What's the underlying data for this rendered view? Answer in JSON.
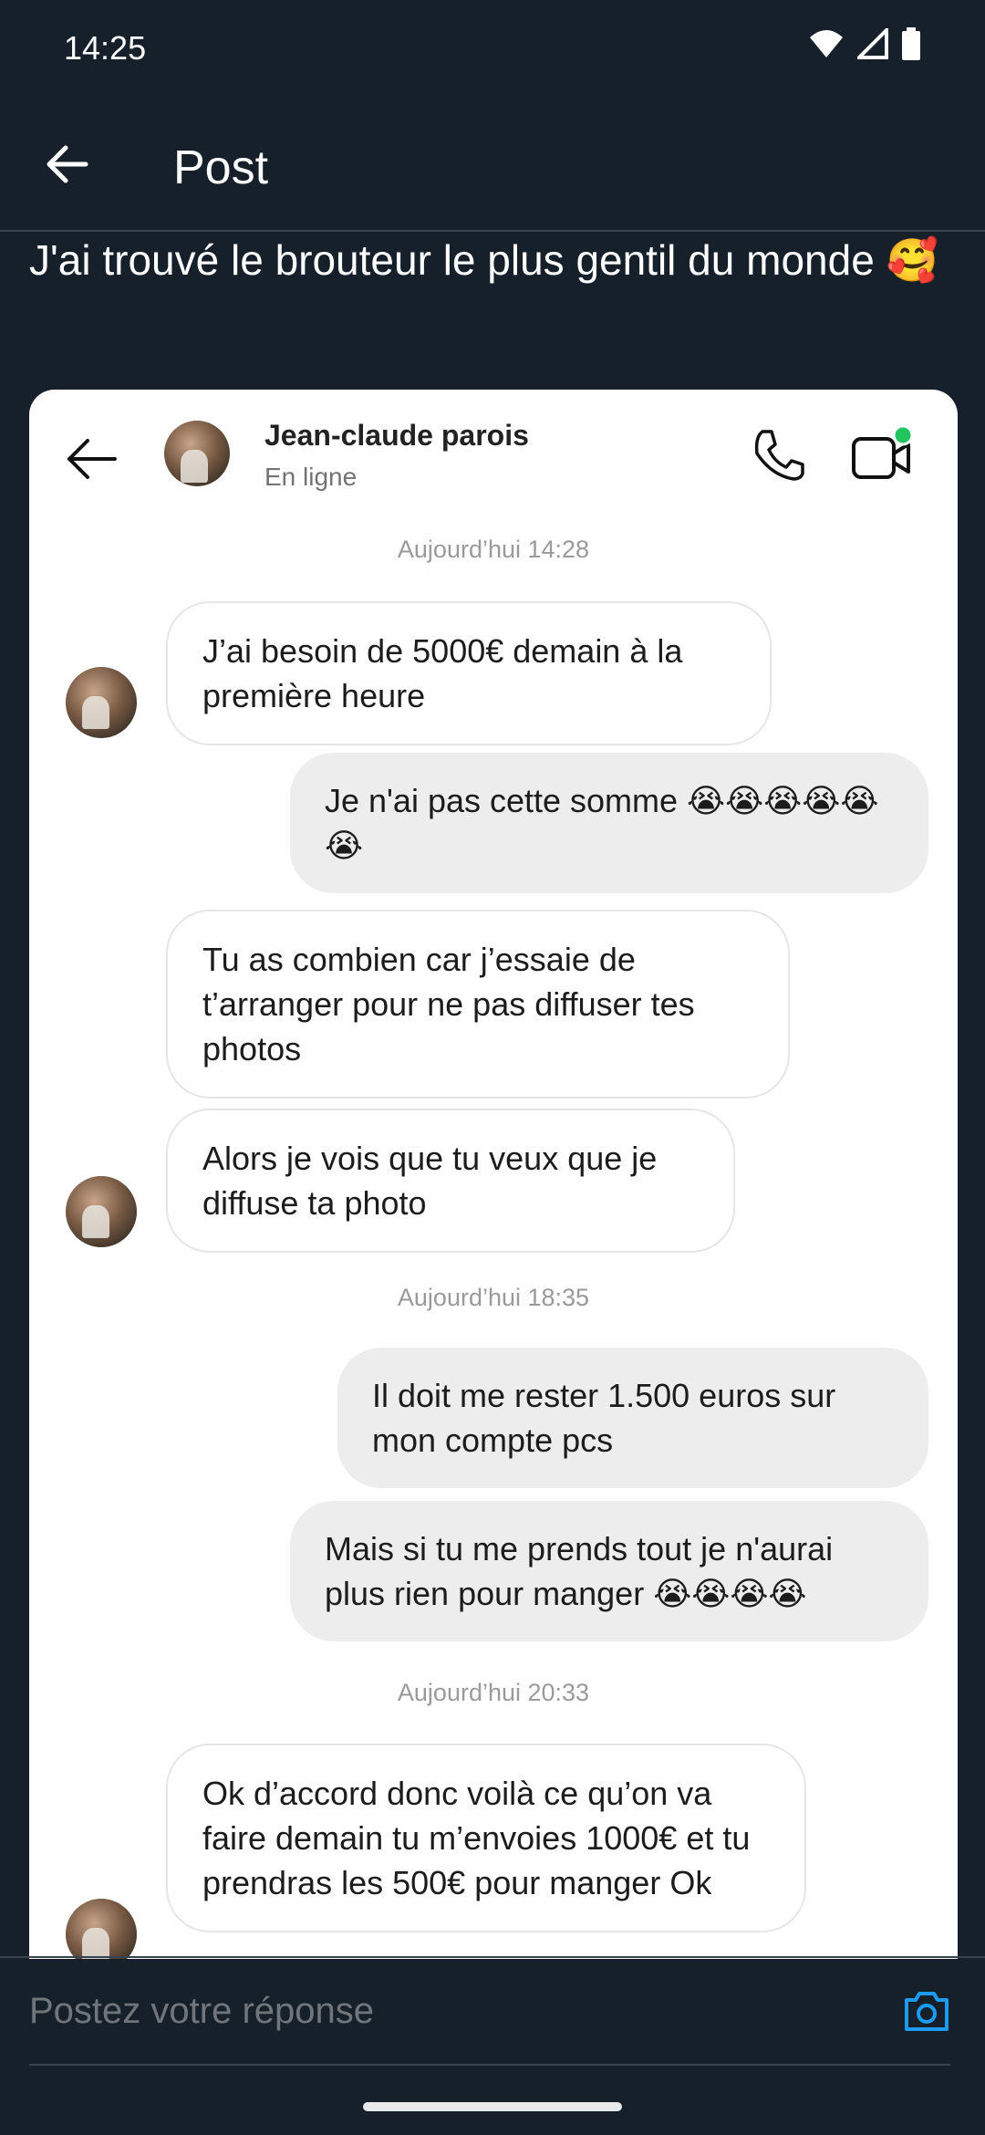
{
  "status_bar": {
    "time": "14:25"
  },
  "app_bar": {
    "title": "Post"
  },
  "post": {
    "text": "J'ai trouvé le brouteur le plus gentil du monde",
    "emoji": "🥰"
  },
  "chat": {
    "contact_name": "Jean-claude parois",
    "contact_status": "En ligne",
    "messages": [
      {
        "type": "stamp",
        "text": "Aujourd’hui 14:28"
      },
      {
        "type": "in",
        "text": "J’ai besoin de 5000€ demain à la première heure"
      },
      {
        "type": "out",
        "text": "Je n'ai pas cette somme 😭😭😭😭😭😭"
      },
      {
        "type": "in",
        "text": "Tu as combien car j’essaie de t’arranger pour ne pas diffuser tes photos"
      },
      {
        "type": "in",
        "text": "Alors je vois que tu veux que je diffuse ta photo"
      },
      {
        "type": "stamp",
        "text": "Aujourd’hui 18:35"
      },
      {
        "type": "out",
        "text": "Il doit me rester 1.500 euros sur mon compte pcs"
      },
      {
        "type": "out",
        "text": "Mais si tu me prends tout je n'aurai plus rien pour manger 😭😭😭😭"
      },
      {
        "type": "stamp",
        "text": "Aujourd’hui 20:33"
      },
      {
        "type": "in",
        "text": "Ok d’accord donc voilà ce qu’on va faire demain tu m’envoies 1000€ et tu prendras les 500€ pour manger Ok"
      }
    ]
  },
  "reply": {
    "placeholder": "Postez votre réponse"
  },
  "colors": {
    "background": "#15202b",
    "accent": "#1d9bf0",
    "online": "#22c55e"
  },
  "icons": [
    "back-arrow-icon",
    "phone-icon",
    "video-call-icon",
    "camera-icon",
    "wifi-icon",
    "signal-icon",
    "battery-icon"
  ]
}
